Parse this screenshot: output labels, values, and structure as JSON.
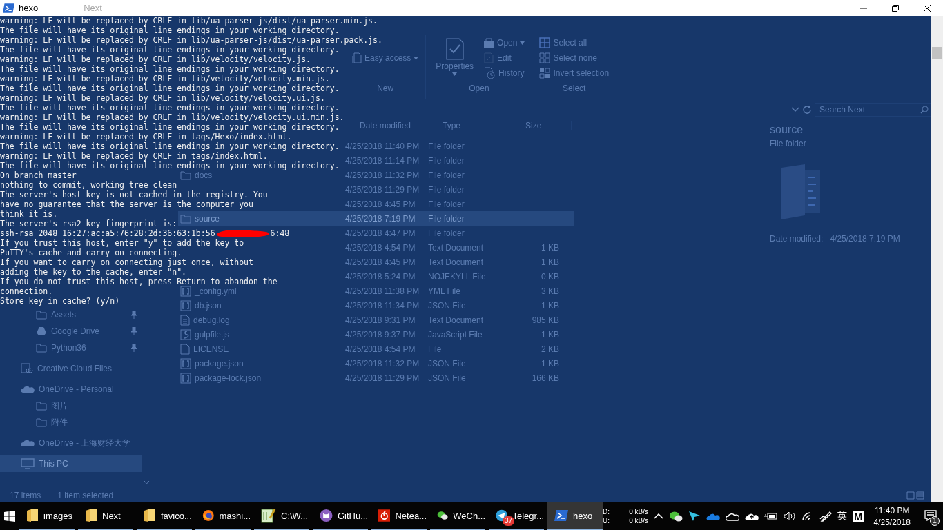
{
  "title_bar": {
    "title": "hexo",
    "behind_title": "Next"
  },
  "terminal": {
    "lines": [
      {
        "kind": "text",
        "text": "warning: LF will be replaced by CRLF in lib/ua-parser-js/dist/ua-parser.min.js."
      },
      {
        "kind": "text",
        "text": "The file will have its original line endings in your working directory."
      },
      {
        "kind": "text",
        "text": "warning: LF will be replaced by CRLF in lib/ua-parser-js/dist/ua-parser.pack.js."
      },
      {
        "kind": "text",
        "text": "The file will have its original line endings in your working directory."
      },
      {
        "kind": "text",
        "text": "warning: LF will be replaced by CRLF in lib/velocity/velocity.js."
      },
      {
        "kind": "text",
        "text": "The file will have its original line endings in your working directory."
      },
      {
        "kind": "text",
        "text": "warning: LF will be replaced by CRLF in lib/velocity/velocity.min.js."
      },
      {
        "kind": "text",
        "text": "The file will have its original line endings in your working directory."
      },
      {
        "kind": "text",
        "text": "warning: LF will be replaced by CRLF in lib/velocity/velocity.ui.js."
      },
      {
        "kind": "text",
        "text": "The file will have its original line endings in your working directory."
      },
      {
        "kind": "text",
        "text": "warning: LF will be replaced by CRLF in lib/velocity/velocity.ui.min.js."
      },
      {
        "kind": "text",
        "text": "The file will have its original line endings in your working directory."
      },
      {
        "kind": "text",
        "text": "warning: LF will be replaced by CRLF in tags/Hexo/index.html."
      },
      {
        "kind": "text",
        "text": "The file will have its original line endings in your working directory."
      },
      {
        "kind": "text",
        "text": "warning: LF will be replaced by CRLF in tags/index.html."
      },
      {
        "kind": "text",
        "text": "The file will have its original line endings in your working directory."
      },
      {
        "kind": "text",
        "text": "On branch master"
      },
      {
        "kind": "text",
        "text": "nothing to commit, working tree clean"
      },
      {
        "kind": "text",
        "text": "The server's host key is not cached in the registry. You"
      },
      {
        "kind": "text",
        "text": "have no guarantee that the server is the computer you"
      },
      {
        "kind": "text",
        "text": "think it is."
      },
      {
        "kind": "text",
        "text": "The server's rsa2 key fingerprint is:"
      },
      {
        "kind": "redacted",
        "text": "ssh-rsa 2048 16:27:ac:a5:76:28:2d:36:63:1b:56",
        "after": "6:48"
      },
      {
        "kind": "text",
        "text": "If you trust this host, enter \"y\" to add the key to"
      },
      {
        "kind": "text",
        "text": "PuTTY's cache and carry on connecting."
      },
      {
        "kind": "text",
        "text": "If you want to carry on connecting just once, without"
      },
      {
        "kind": "text",
        "text": "adding the key to the cache, enter \"n\"."
      },
      {
        "kind": "text",
        "text": "If you do not trust this host, press Return to abandon the"
      },
      {
        "kind": "text",
        "text": "connection."
      },
      {
        "kind": "text",
        "text": "Store key in cache? (y/n)"
      }
    ]
  },
  "explorer": {
    "ribbon": {
      "groups": [
        {
          "label": "New",
          "commands": [
            {
              "label": "Easy access",
              "kind": "easy-access",
              "dropdown": true
            }
          ]
        },
        {
          "label": "Open",
          "large": {
            "label": "Properties",
            "kind": "properties",
            "dropdown": true
          },
          "commands": [
            {
              "label": "Open",
              "kind": "open",
              "dropdown": true
            },
            {
              "label": "Edit",
              "kind": "edit"
            },
            {
              "label": "History",
              "kind": "history"
            }
          ]
        },
        {
          "label": "Select",
          "commands": [
            {
              "label": "Select all",
              "kind": "select-all"
            },
            {
              "label": "Select none",
              "kind": "select-none"
            },
            {
              "label": "Invert selection",
              "kind": "invert"
            }
          ]
        }
      ]
    },
    "search": {
      "placeholder": "Search Next"
    },
    "columns": [
      "Date modified",
      "Type",
      "Size"
    ],
    "sidebar": [
      {
        "label": "Assets",
        "kind": "folder",
        "pinned": true,
        "selected": false
      },
      {
        "label": "Google Drive",
        "kind": "drive",
        "pinned": true,
        "selected": false
      },
      {
        "label": "Python36",
        "kind": "folder",
        "pinned": true,
        "selected": false
      },
      {
        "label": "Creative Cloud Files",
        "kind": "creative",
        "selected": false
      },
      {
        "label": "OneDrive - Personal",
        "kind": "cloud",
        "selected": false,
        "children": [
          {
            "label": "图片",
            "kind": "folder",
            "selected": false
          },
          {
            "label": "附件",
            "kind": "folder",
            "selected": false
          }
        ]
      },
      {
        "label": "OneDrive - 上海财经大学",
        "kind": "cloud",
        "selected": false
      },
      {
        "label": "This PC",
        "kind": "pc",
        "selected": true
      }
    ],
    "rows": [
      {
        "date": "4/25/2018 11:40 PM",
        "type": "File folder",
        "selected": false
      },
      {
        "date": "4/25/2018 11:14 PM",
        "type": "File folder",
        "selected": false
      },
      {
        "name": "docs",
        "kind": "folder",
        "date": "4/25/2018 11:32 PM",
        "type": "File folder",
        "selected": false
      },
      {
        "date": "4/25/2018 11:29 PM",
        "type": "File folder",
        "selected": false
      },
      {
        "date": "4/25/2018 4:45 PM",
        "type": "File folder",
        "selected": false
      },
      {
        "name": "source",
        "kind": "folder",
        "date": "4/25/2018 7:19 PM",
        "type": "File folder",
        "selected": true
      },
      {
        "date": "4/25/2018 4:47 PM",
        "type": "File folder",
        "selected": false
      },
      {
        "date": "4/25/2018 4:54 PM",
        "type": "Text Document",
        "size": "1 KB",
        "selected": false
      },
      {
        "date": "4/25/2018 4:45 PM",
        "type": "Text Document",
        "size": "1 KB",
        "selected": false
      },
      {
        "date": "4/25/2018 5:24 PM",
        "type": "NOJEKYLL File",
        "size": "0 KB",
        "selected": false
      },
      {
        "name": "_config.yml",
        "kind": "json",
        "date": "4/25/2018 11:38 PM",
        "type": "YML File",
        "size": "3 KB",
        "selected": false
      },
      {
        "name": "db.json",
        "kind": "json",
        "date": "4/25/2018 11:34 PM",
        "type": "JSON File",
        "size": "1 KB",
        "selected": false
      },
      {
        "name": "debug.log",
        "kind": "text",
        "date": "4/25/2018 9:31 PM",
        "type": "Text Document",
        "size": "985 KB",
        "selected": false
      },
      {
        "name": "gulpfile.js",
        "kind": "script",
        "date": "4/25/2018 9:37 PM",
        "type": "JavaScript File",
        "size": "1 KB",
        "selected": false
      },
      {
        "name": "LICENSE",
        "kind": "file",
        "date": "4/25/2018 4:54 PM",
        "type": "File",
        "size": "2 KB",
        "selected": false
      },
      {
        "name": "package.json",
        "kind": "json",
        "date": "4/25/2018 11:32 PM",
        "type": "JSON File",
        "size": "1 KB",
        "selected": false
      },
      {
        "name": "package-lock.json",
        "kind": "json",
        "date": "4/25/2018 11:29 PM",
        "type": "JSON File",
        "size": "166 KB",
        "selected": false
      }
    ],
    "details": {
      "name": "source",
      "type": "File folder",
      "date_label": "Date modified:",
      "date": "4/25/2018 7:19 PM"
    },
    "status": {
      "count": "17 items",
      "selection": "1 item selected"
    }
  },
  "taskbar": {
    "items": [
      {
        "label": "images",
        "kind": "folder",
        "selected": false
      },
      {
        "label": "Next",
        "kind": "folder",
        "selected": false
      },
      {
        "label": "favico...",
        "kind": "folder",
        "selected": false
      },
      {
        "label": "mashi...",
        "kind": "browser",
        "selected": false
      },
      {
        "label": "C:\\W...",
        "kind": "notepad",
        "selected": false
      },
      {
        "label": "GitHu...",
        "kind": "cat",
        "selected": false
      },
      {
        "label": "Netea...",
        "kind": "music",
        "selected": false
      },
      {
        "label": "WeCh...",
        "kind": "chat",
        "selected": false
      },
      {
        "label": "Telegr...",
        "kind": "plane",
        "selected": false,
        "badge": "37"
      },
      {
        "label": "hexo",
        "kind": "shell",
        "selected": true
      }
    ],
    "net": {
      "down_label": "D:",
      "down": "0 kB/s",
      "up_label": "U:",
      "up": "0 kB/s"
    },
    "ime": "英",
    "ime_mode": "M",
    "time": "11:40 PM",
    "date": "4/25/2018",
    "notifications": "1"
  }
}
